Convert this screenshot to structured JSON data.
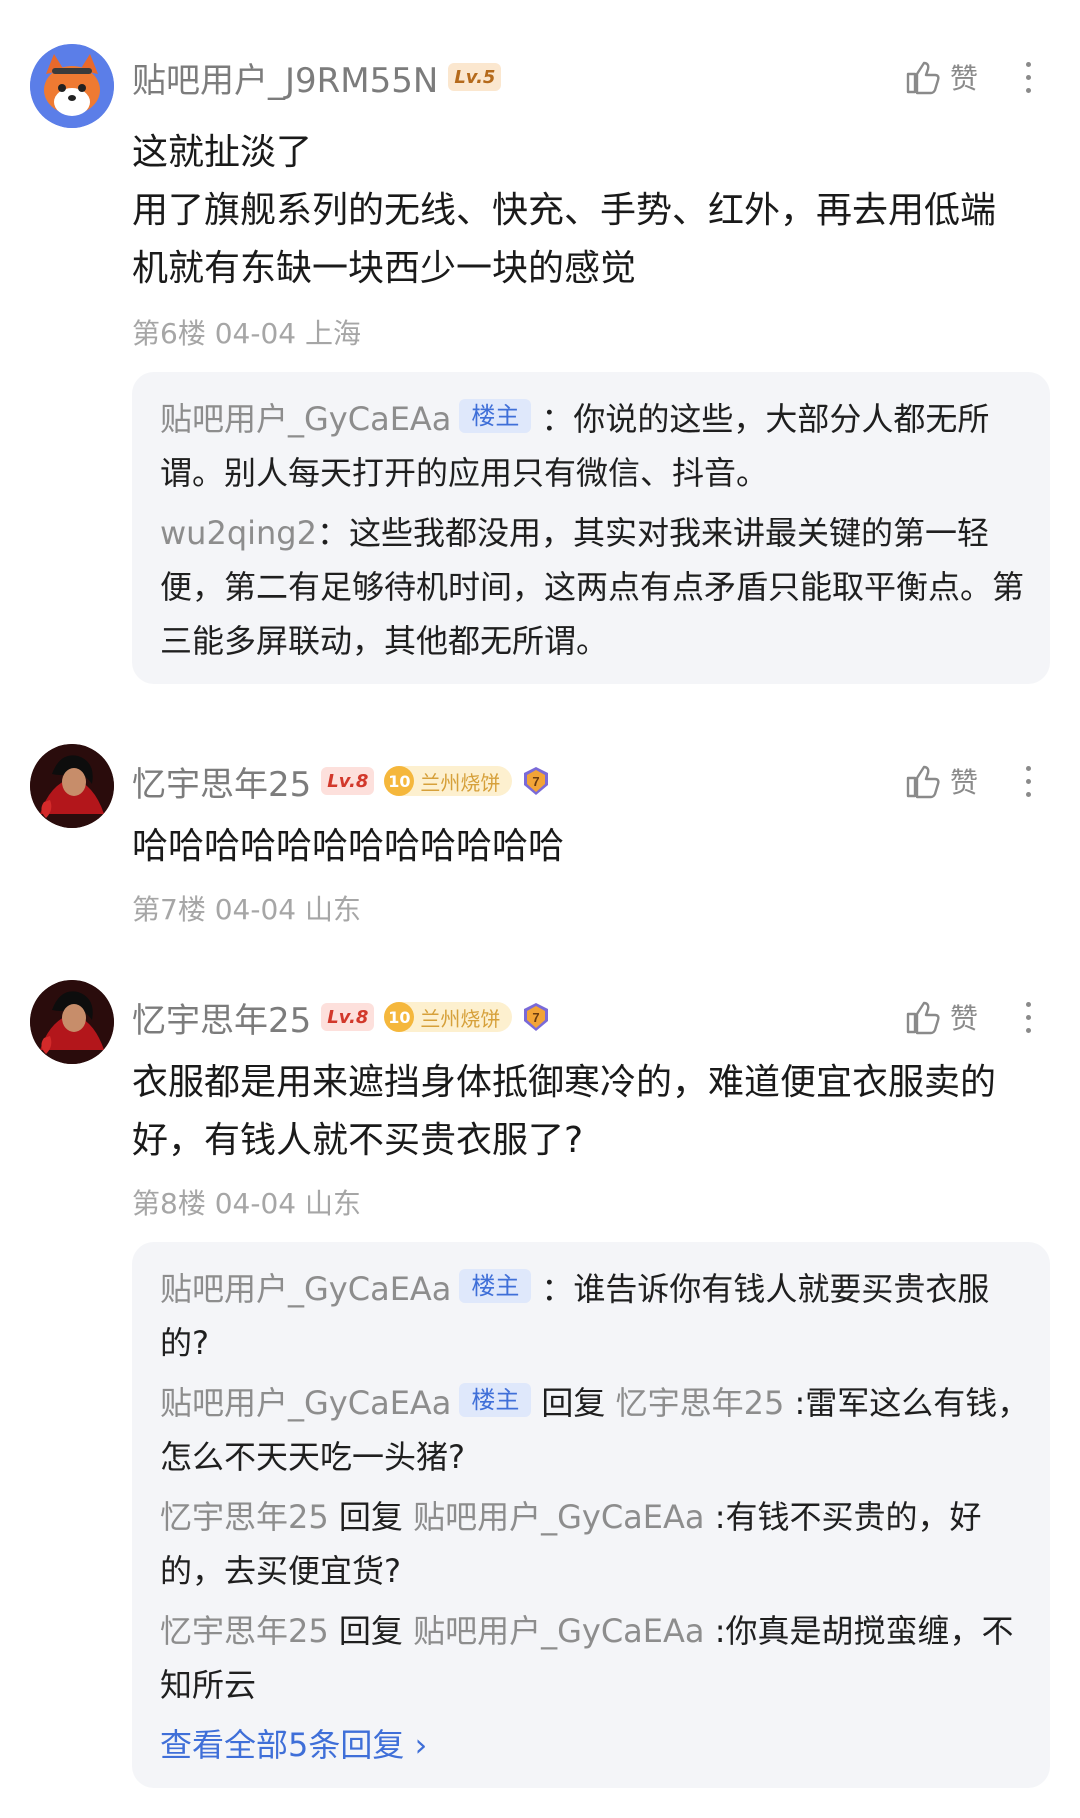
{
  "comments": [
    {
      "username": "贴吧用户_J9RM55N",
      "level": "Lv.5",
      "like_label": "赞",
      "content": [
        "这就扯淡了",
        "用了旗舰系列的无线、快充、手势、红外，再去用低端",
        "机就有东缺一块西少一块的感觉"
      ],
      "floor": "第6楼",
      "date": "04-04",
      "location": "上海",
      "replies": [
        {
          "name": "贴吧用户_GyCaEAa",
          "badge": "楼主",
          "text": "：你说的这些，大部分人都无所谓。别人每天打开的应用只有微信、抖音。"
        },
        {
          "name": "wu2qing2",
          "text": "：这些我都没用，其实对我来讲最关键的第一轻便，第二有足够待机时间，这两点有点矛盾只能取平衡点。第三能多屏联动，其他都无所谓。"
        }
      ]
    },
    {
      "username": "忆宇思年25",
      "level": "Lv.8",
      "medal_num": "10",
      "medal_text": "兰州烧饼",
      "badge_num": "7",
      "like_label": "赞",
      "content": [
        "哈哈哈哈哈哈哈哈哈哈哈哈"
      ],
      "floor": "第7楼",
      "date": "04-04",
      "location": "山东"
    },
    {
      "username": "忆宇思年25",
      "level": "Lv.8",
      "medal_num": "10",
      "medal_text": "兰州烧饼",
      "badge_num": "7",
      "like_label": "赞",
      "content": [
        "衣服都是用来遮挡身体抵御寒冷的，难道便宜衣服卖的",
        "好，有钱人就不买贵衣服了?"
      ],
      "floor": "第8楼",
      "date": "04-04",
      "location": "山东",
      "replies": [
        {
          "name": "贴吧用户_GyCaEAa",
          "badge": "楼主",
          "text": "：谁告诉你有钱人就要买贵衣服的?"
        },
        {
          "name": "贴吧用户_GyCaEAa",
          "badge": "楼主",
          "reply_word": "回复",
          "target": "忆宇思年25",
          "text": ":雷军这么有钱，怎么不天天吃一头猪?"
        },
        {
          "name": "忆宇思年25",
          "reply_word": "回复",
          "target": "贴吧用户_GyCaEAa",
          "text": ":有钱不买贵的，好的，去买便宜货?"
        },
        {
          "name": "忆宇思年25",
          "reply_word": "回复",
          "target": "贴吧用户_GyCaEAa",
          "text": ":你真是胡搅蛮缠，不知所云"
        }
      ],
      "see_all": "查看全部5条回复"
    }
  ],
  "colors": {
    "link": "#3f6fd8",
    "muted": "#8d8d8d",
    "reply_bg": "#f4f5f8"
  },
  "icons": [
    "avatar-fox",
    "avatar-red-character",
    "thumbs-up-icon",
    "more-vertical-icon",
    "chevron-right-icon"
  ]
}
